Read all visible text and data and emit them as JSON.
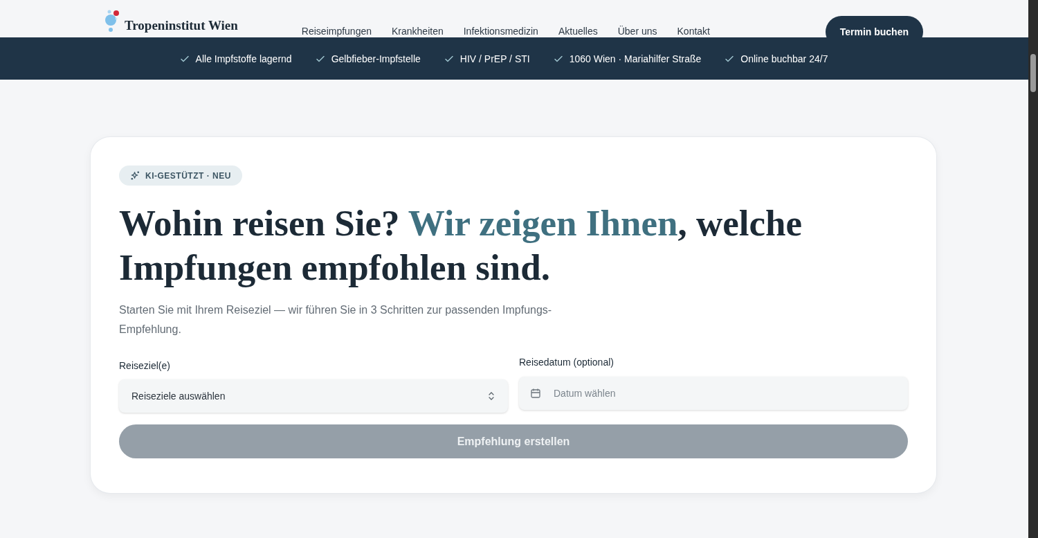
{
  "header": {
    "logo": "Tropeninstitut Wien",
    "nav": [
      "Reiseimpfungen",
      "Krankheiten",
      "Infektionsmedizin",
      "Aktuelles",
      "Über uns",
      "Kontakt"
    ],
    "cta": "Termin buchen"
  },
  "banner": [
    "Alle Impfstoffe lagernd",
    "Gelbfieber-Impfstelle",
    "HIV / PrEP / STI",
    "1060 Wien · Mariahilfer Straße",
    "Online buchbar 24/7"
  ],
  "card": {
    "badge": "KI-GESTÜTZT · NEU",
    "heading": [
      {
        "text": "Wohin reisen Sie? ",
        "accent": false
      },
      {
        "text": "Wir zeigen Ihnen",
        "accent": true
      },
      {
        "text": ", welche Impfungen empfohlen sind.",
        "accent": false
      }
    ],
    "intro": "Starten Sie mit Ihrem Reiseziel — wir führen Sie in 3 Schritten zur passenden Impfungs-Empfehlung.",
    "destination": {
      "label": "Reiseziel(e)",
      "value": "Reiseziele auswählen"
    },
    "date": {
      "label": "Reisedatum (optional)",
      "placeholder": "Datum wählen"
    },
    "submit": {
      "label": "Empfehlung erstellen",
      "disabled": true
    }
  }
}
